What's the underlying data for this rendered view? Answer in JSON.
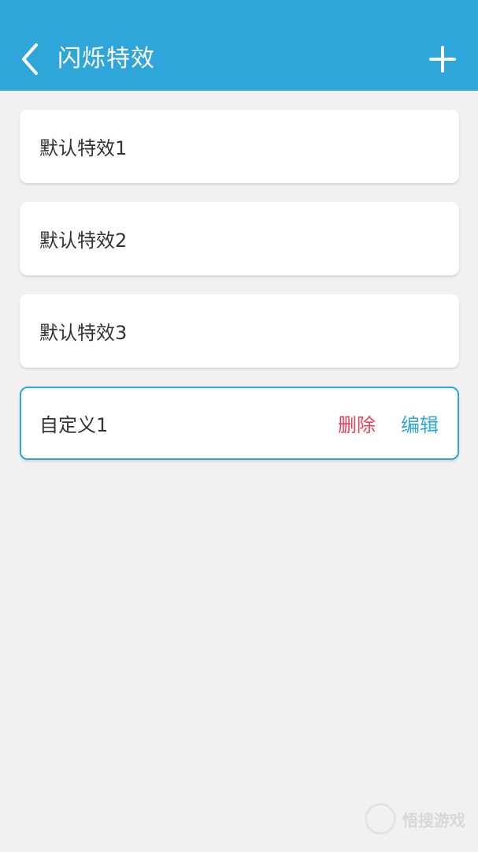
{
  "header": {
    "title": "闪烁特效",
    "back_icon": "chevron-left-icon",
    "add_icon": "plus-icon",
    "background_color": "#2ea6d9"
  },
  "effects": [
    {
      "label": "默认特效1"
    },
    {
      "label": "默认特效2"
    },
    {
      "label": "默认特效3"
    }
  ],
  "custom": {
    "label": "自定义1",
    "delete_label": "删除",
    "edit_label": "编辑",
    "delete_color": "#e8415a",
    "edit_color": "#2ea6d9"
  },
  "watermark": {
    "text": "悟搜游戏"
  }
}
